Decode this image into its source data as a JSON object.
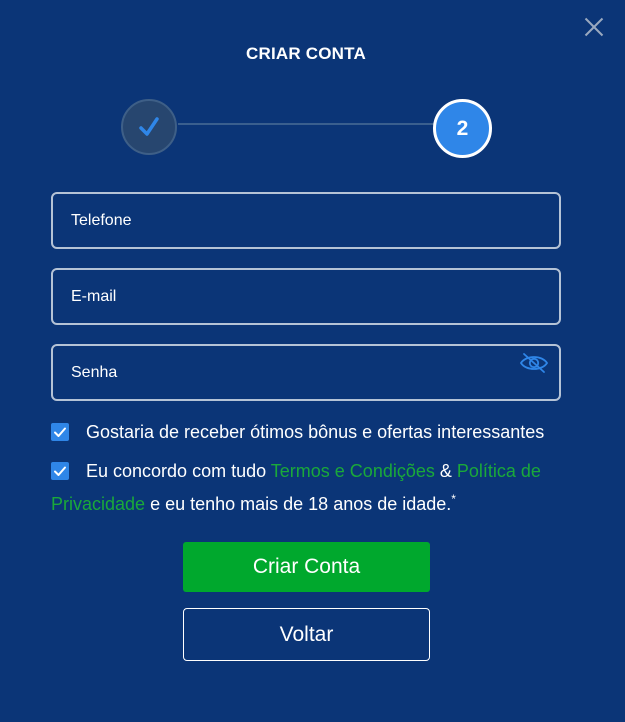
{
  "modal": {
    "title": "CRIAR CONTA",
    "close_icon": "close-icon"
  },
  "steps": {
    "step1_icon": "checkmark-icon",
    "step2_label": "2",
    "active_color": "#2f86e8",
    "done_color": "#27466f"
  },
  "form": {
    "phone_placeholder": "Telefone",
    "email_placeholder": "E-mail",
    "password_placeholder": "Senha",
    "password_toggle_icon": "eye-slash-icon"
  },
  "consent": {
    "bonus_text": "Gostaria de receber ótimos bônus e ofertas interessantes",
    "bonus_checked": true,
    "terms_prefix": "Eu concordo com tudo ",
    "terms_link": "Termos e Condições",
    "terms_and": " & ",
    "privacy_link": "Política de Privacidade",
    "terms_suffix": " e eu tenho mais de 18 anos de idade.",
    "required_mark": "*",
    "terms_checked": true
  },
  "actions": {
    "create_label": "Criar Conta",
    "back_label": "Voltar"
  },
  "colors": {
    "background": "#0b3577",
    "accent": "#2f86e8",
    "primary_button": "#00a82d",
    "link": "#1aa93a"
  }
}
